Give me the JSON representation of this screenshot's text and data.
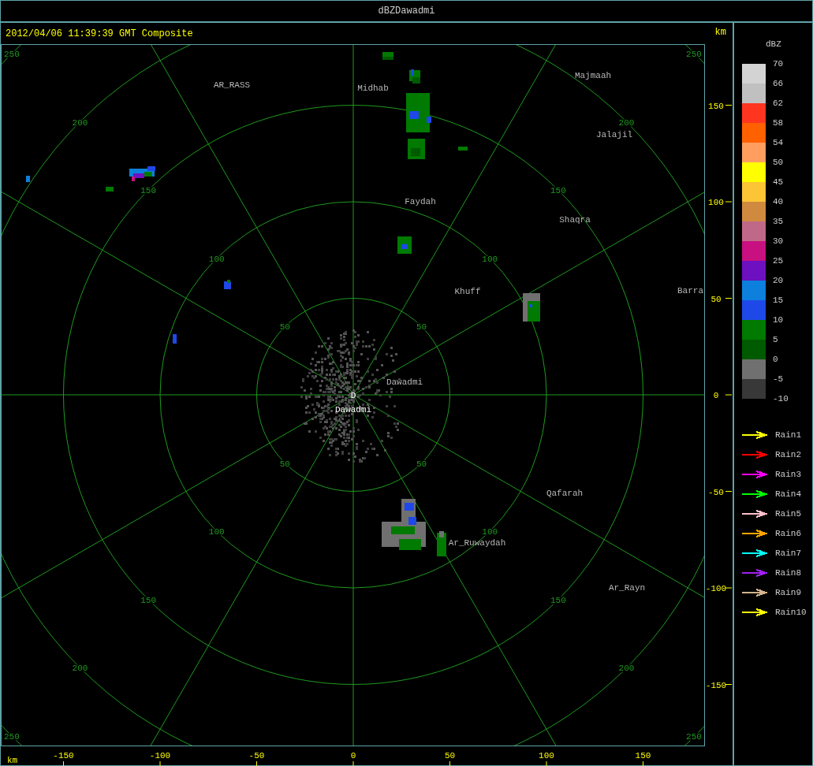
{
  "window": {
    "title": "dBZDawadmi"
  },
  "header": {
    "timestamp": "2012/04/06 11:39:39 GMT Composite",
    "unit": "km"
  },
  "map": {
    "range_rings": [
      {
        "labels": [
          "50",
          "50",
          "50",
          "50"
        ]
      },
      {
        "labels": [
          "100",
          "100",
          "100",
          "100"
        ]
      },
      {
        "labels": [
          "150",
          "150",
          "150",
          "150"
        ]
      },
      {
        "labels": [
          "200",
          "200",
          "200",
          "200"
        ]
      },
      {
        "labels": [
          "250",
          "250",
          "250",
          "250"
        ]
      }
    ],
    "places": [
      {
        "name": "AR_RASS"
      },
      {
        "name": "Midhab"
      },
      {
        "name": "Majmaah"
      },
      {
        "name": "Jalajil"
      },
      {
        "name": "Faydah"
      },
      {
        "name": "Shaqra"
      },
      {
        "name": "Khuff"
      },
      {
        "name": "Barra"
      },
      {
        "name": "Dawadmi"
      },
      {
        "name": "Qafarah"
      },
      {
        "name": "Ar_Ruwaydah"
      },
      {
        "name": "Ar_Rayn"
      }
    ],
    "radar_site": {
      "marker": "D",
      "name": "Dawadmi"
    },
    "y_axis": {
      "ticks": [
        "150",
        "100",
        "50",
        "0",
        "-50",
        "-100",
        "-150"
      ]
    },
    "x_axis": {
      "unit": "km",
      "ticks": [
        "-150",
        "-100",
        "-50",
        "0",
        "50",
        "100",
        "150"
      ]
    }
  },
  "legend": {
    "title": "dBZ",
    "scale_labels": [
      "70",
      "66",
      "62",
      "58",
      "54",
      "50",
      "45",
      "40",
      "35",
      "30",
      "25",
      "20",
      "15",
      "10",
      "5",
      "0",
      "-5",
      "-10"
    ],
    "swatches": [
      {
        "color": "#d3d3d3"
      },
      {
        "color": "#c0c0c0"
      },
      {
        "color": "#ff3520"
      },
      {
        "color": "#ff6000"
      },
      {
        "color": "#ff9e5e"
      },
      {
        "color": "#ffff00"
      },
      {
        "color": "#fbc535"
      },
      {
        "color": "#d08a40"
      },
      {
        "color": "#c06888"
      },
      {
        "color": "#c81080"
      },
      {
        "color": "#6c10c0"
      },
      {
        "color": "#0c80dc"
      },
      {
        "color": "#1e48e8"
      },
      {
        "color": "#007a00"
      },
      {
        "color": "#005a00"
      },
      {
        "color": "#707070"
      },
      {
        "color": "#383838"
      }
    ],
    "tracks": [
      {
        "label": "Rain1",
        "color": "#ffff00"
      },
      {
        "label": "Rain2",
        "color": "#ff0000"
      },
      {
        "label": "Rain3",
        "color": "#ff00ff"
      },
      {
        "label": "Rain4",
        "color": "#00ff00"
      },
      {
        "label": "Rain5",
        "color": "#ffc0cb"
      },
      {
        "label": "Rain6",
        "color": "#ffa500"
      },
      {
        "label": "Rain7",
        "color": "#00ffff"
      },
      {
        "label": "Rain8",
        "color": "#a020f0"
      },
      {
        "label": "Rain9",
        "color": "#d2b48c"
      },
      {
        "label": "Rain10",
        "color": "#ffff00"
      }
    ]
  }
}
